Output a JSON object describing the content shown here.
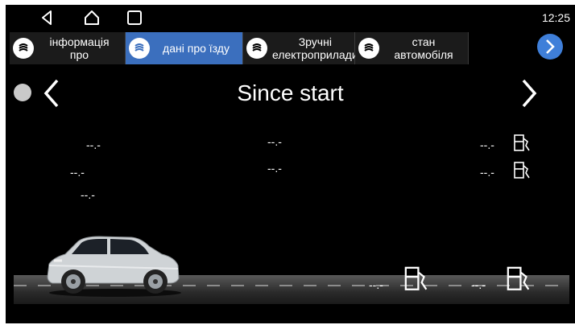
{
  "status": {
    "time": "12:25"
  },
  "tabs": [
    {
      "label": "інформація про",
      "icon": "menu-circle-icon",
      "active": false
    },
    {
      "label": "дані про їзду",
      "icon": "menu-circle-icon",
      "active": true
    },
    {
      "label": "Зручні електроприлади",
      "icon": "menu-circle-icon",
      "active": false
    },
    {
      "label": "стан автомобіля",
      "icon": "menu-circle-icon",
      "active": false
    }
  ],
  "trip": {
    "title": "Since start",
    "values": {
      "v1": "--.-",
      "v2": "--.-",
      "v3": "--.-",
      "v4": "--.-",
      "v5": "--.-",
      "v6": "--.-",
      "v7": "--.-",
      "v8": "--.-",
      "v9": "--.-"
    }
  },
  "colors": {
    "accent": "#3b6fbe",
    "background": "#000000"
  }
}
